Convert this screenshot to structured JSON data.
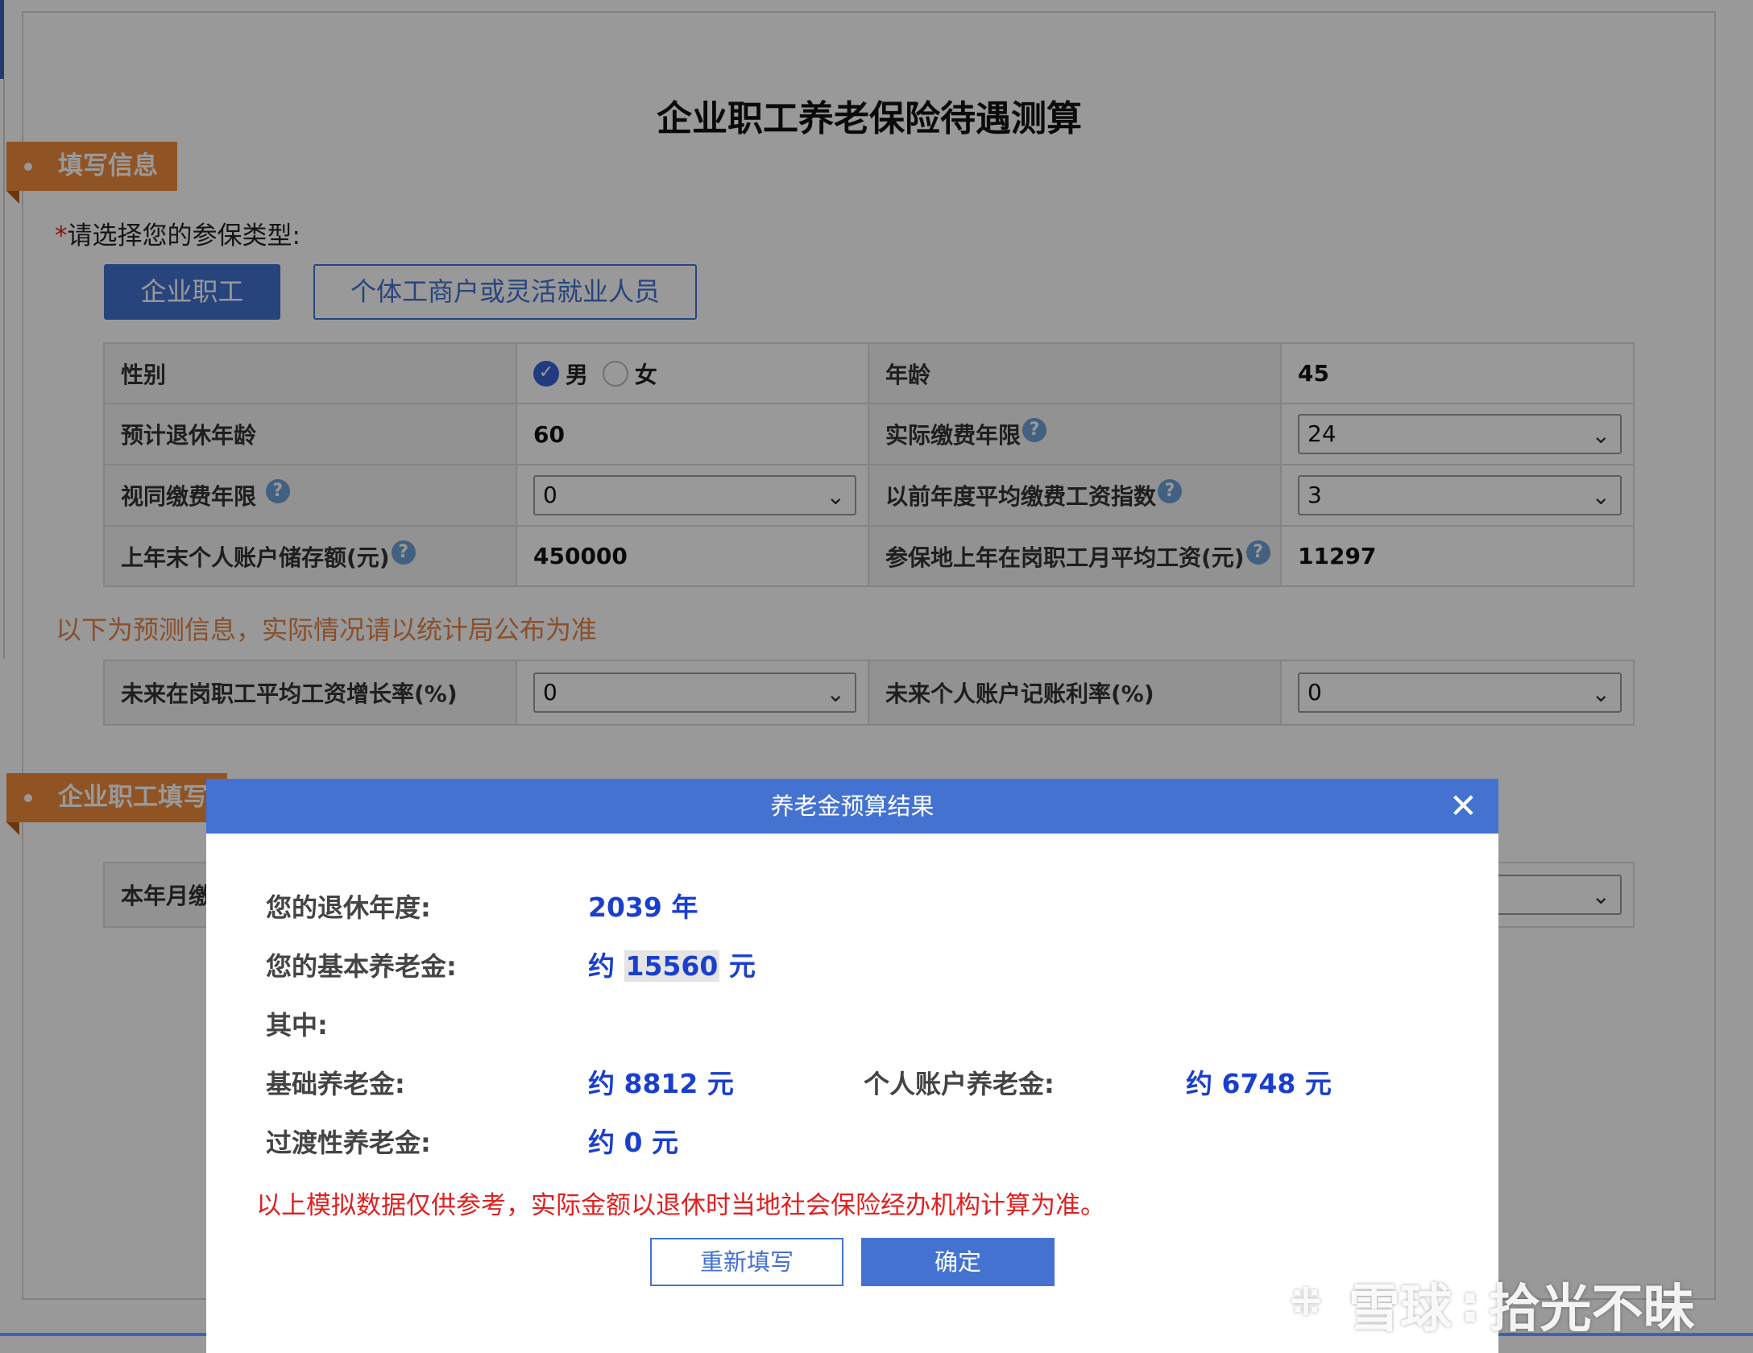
{
  "page": {
    "title": "企业职工养老保险待遇测算"
  },
  "section1": {
    "ribbon": "填写信息",
    "type_prompt_star": "*",
    "type_prompt": "请选择您的参保类型:",
    "type_buttons": [
      "企业职工",
      "个体工商户或灵活就业人员"
    ]
  },
  "form": {
    "gender_label": "性别",
    "gender_options": [
      "男",
      "女"
    ],
    "gender_selected": "男",
    "age_label": "年龄",
    "age_value": "45",
    "retire_age_label": "预计退休年龄",
    "retire_age_value": "60",
    "actual_years_label": "实际缴费年限",
    "actual_years_value": "24",
    "deemed_years_label": "视同缴费年限",
    "deemed_years_value": "0",
    "prev_index_label": "以前年度平均缴费工资指数",
    "prev_index_value": "3",
    "account_balance_label": "上年末个人账户储存额(元)",
    "account_balance_value": "450000",
    "avg_wage_label": "参保地上年在岗职工月平均工资(元)",
    "avg_wage_value": "11297"
  },
  "forecast": {
    "note": "以下为预测信息，实际情况请以统计局公布为准",
    "wage_growth_label": "未来在岗职工平均工资增长率(%)",
    "wage_growth_value": "0",
    "account_rate_label": "未来个人账户记账利率(%)",
    "account_rate_value": "0"
  },
  "section2": {
    "ribbon": "企业职工填写",
    "row_label": "本年月缴"
  },
  "modal": {
    "title": "养老金预算结果",
    "close": "✕",
    "retire_year_label": "您的退休年度:",
    "retire_year_value": "2039",
    "retire_year_unit": "年",
    "basic_pension_label": "您的基本养老金:",
    "approx": "约",
    "basic_pension_value": "15560",
    "yuan": "元",
    "of_which_label": "其中:",
    "base_pension_label": "基础养老金:",
    "base_pension_value": "8812",
    "personal_pension_label": "个人账户养老金:",
    "personal_pension_value": "6748",
    "transition_pension_label": "过渡性养老金:",
    "transition_pension_value": "0",
    "disclaimer": "以上模拟数据仅供参考，实际金额以退休时当地社会保险经办机构计算为准。",
    "refill_button": "重新填写",
    "confirm_button": "确定"
  },
  "watermark": {
    "brand": "雪球",
    "separator": ":",
    "author": "拾光不昧"
  },
  "icons": {
    "help": "question-circle-icon",
    "dropdown": "chevron-down-icon",
    "radio_checked": "check-icon",
    "close": "close-icon"
  },
  "colors": {
    "primary": "#4472d1",
    "ribbon": "#f08a3c",
    "forecast_note": "#e4854a",
    "result_value": "#1a3fcc",
    "disclaimer": "#e02020"
  }
}
